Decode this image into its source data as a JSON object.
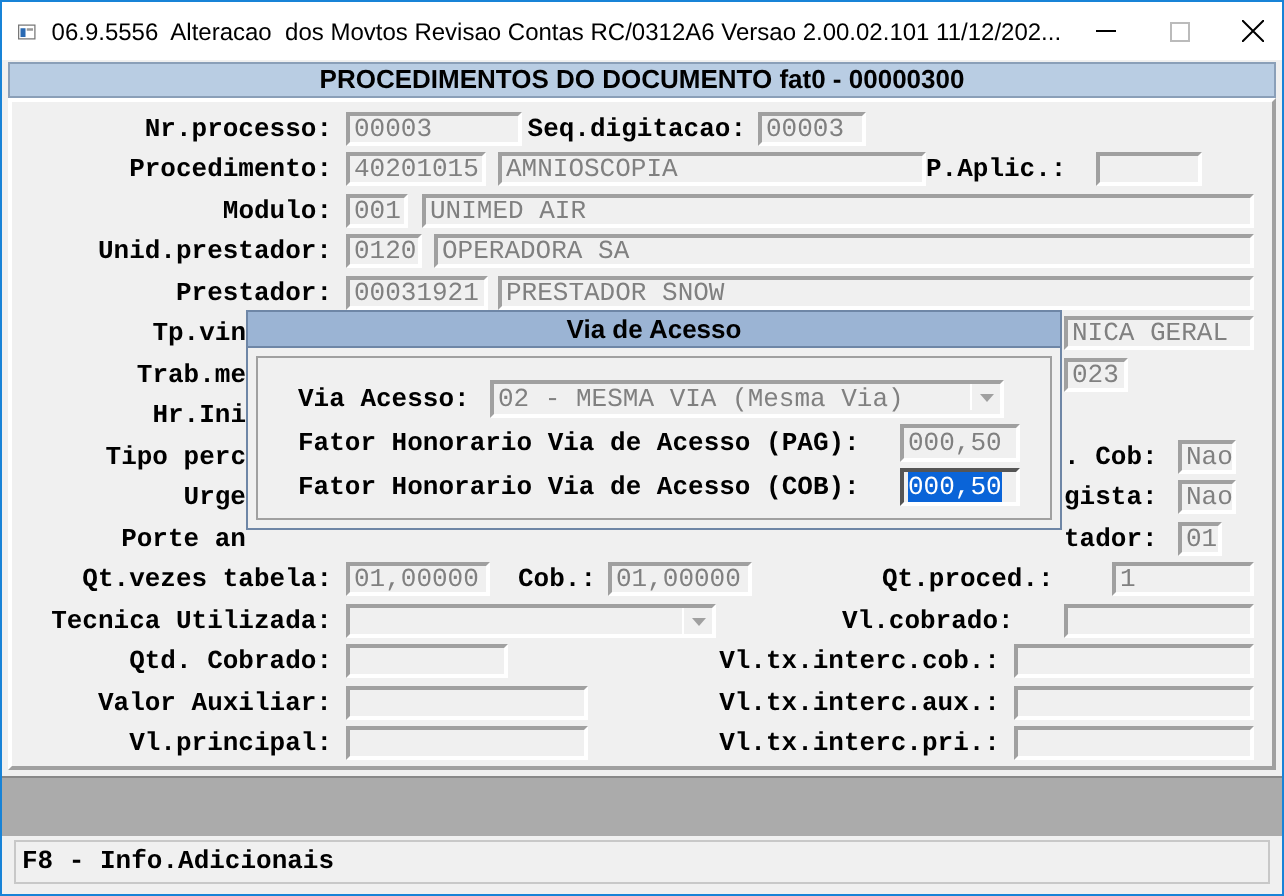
{
  "window": {
    "title": "06.9.5556  Alteracao  dos Movtos Revisao Contas RC/0312A6 Versao 2.00.02.101 11/12/202..."
  },
  "form": {
    "title": "PROCEDIMENTOS DO DOCUMENTO fat0 - 00000300",
    "rows": [
      {
        "items": [
          {
            "kind": "label",
            "text": "Nr.processo:"
          },
          {
            "kind": "field",
            "value": "00003"
          },
          {
            "kind": "label",
            "text": "Seq.digitacao:"
          },
          {
            "kind": "field",
            "value": "00003"
          }
        ]
      },
      {
        "items": [
          {
            "kind": "label",
            "text": "Procedimento:"
          },
          {
            "kind": "field",
            "value": "40201015"
          },
          {
            "kind": "field",
            "value": "AMNIOSCOPIA"
          },
          {
            "kind": "label",
            "text": "P.Aplic.:"
          },
          {
            "kind": "field",
            "value": ""
          }
        ]
      },
      {
        "items": [
          {
            "kind": "label",
            "text": "Modulo:"
          },
          {
            "kind": "field",
            "value": "001"
          },
          {
            "kind": "field",
            "value": "UNIMED AIR"
          }
        ]
      },
      {
        "items": [
          {
            "kind": "label",
            "text": "Unid.prestador:"
          },
          {
            "kind": "field",
            "value": "0120"
          },
          {
            "kind": "field",
            "value": "OPERADORA SA"
          }
        ]
      },
      {
        "items": [
          {
            "kind": "label",
            "text": "Prestador:"
          },
          {
            "kind": "field",
            "value": "00031921"
          },
          {
            "kind": "field",
            "value": "PRESTADOR SNOW"
          }
        ]
      },
      {
        "items": [
          {
            "kind": "label",
            "text": "Tp.vin"
          },
          {
            "kind": "field",
            "value": "NICA GERAL"
          }
        ]
      },
      {
        "items": [
          {
            "kind": "label",
            "text": "Trab.me"
          },
          {
            "kind": "field",
            "value": "023"
          }
        ]
      },
      {
        "items": [
          {
            "kind": "label",
            "text": "Hr.Ini"
          }
        ]
      },
      {
        "items": [
          {
            "kind": "label",
            "text": "Tipo perc"
          },
          {
            "kind": "label",
            "text": ". Cob:"
          },
          {
            "kind": "field",
            "value": "Nao"
          }
        ]
      },
      {
        "items": [
          {
            "kind": "label",
            "text": "Urge"
          },
          {
            "kind": "label",
            "text": "gista:"
          },
          {
            "kind": "field",
            "value": "Nao"
          }
        ]
      },
      {
        "items": [
          {
            "kind": "label",
            "text": "Porte an"
          },
          {
            "kind": "label",
            "text": "tador:"
          },
          {
            "kind": "field",
            "value": "01"
          }
        ]
      },
      {
        "items": [
          {
            "kind": "label",
            "text": "Qt.vezes tabela:"
          },
          {
            "kind": "field",
            "value": "01,00000"
          },
          {
            "kind": "label",
            "text": "Cob.:"
          },
          {
            "kind": "field",
            "value": "01,00000"
          },
          {
            "kind": "label",
            "text": "Qt.proced.:"
          },
          {
            "kind": "field",
            "value": "1"
          }
        ]
      },
      {
        "items": [
          {
            "kind": "label",
            "text": "Tecnica Utilizada:"
          },
          {
            "kind": "combo",
            "value": ""
          },
          {
            "kind": "label",
            "text": "Vl.cobrado:"
          },
          {
            "kind": "field",
            "value": ""
          }
        ]
      },
      {
        "items": [
          {
            "kind": "label",
            "text": "Qtd. Cobrado:"
          },
          {
            "kind": "field",
            "value": ""
          },
          {
            "kind": "label",
            "text": "Vl.tx.interc.cob.:"
          },
          {
            "kind": "field",
            "value": ""
          }
        ]
      },
      {
        "items": [
          {
            "kind": "label",
            "text": "Valor Auxiliar:"
          },
          {
            "kind": "field",
            "value": ""
          },
          {
            "kind": "label",
            "text": "Vl.tx.interc.aux.:"
          },
          {
            "kind": "field",
            "value": ""
          }
        ]
      },
      {
        "items": [
          {
            "kind": "label",
            "text": "Vl.principal:"
          },
          {
            "kind": "field",
            "value": ""
          },
          {
            "kind": "label",
            "text": "Vl.tx.interc.pri.:"
          },
          {
            "kind": "field",
            "value": ""
          }
        ]
      }
    ]
  },
  "dialog": {
    "title": "Via de Acesso",
    "via_label": "Via Acesso:",
    "via_value": "02 - MESMA VIA (Mesma Via)",
    "fields": [
      {
        "label": "Fator Honorario Via de Acesso (PAG):",
        "value": "000,50",
        "text_selected": false
      },
      {
        "label": "Fator Honorario Via de Acesso (COB):",
        "value": "000,50",
        "text_selected": true
      }
    ]
  },
  "status_bar": {
    "text": "F8 - Info.Adicionais"
  }
}
